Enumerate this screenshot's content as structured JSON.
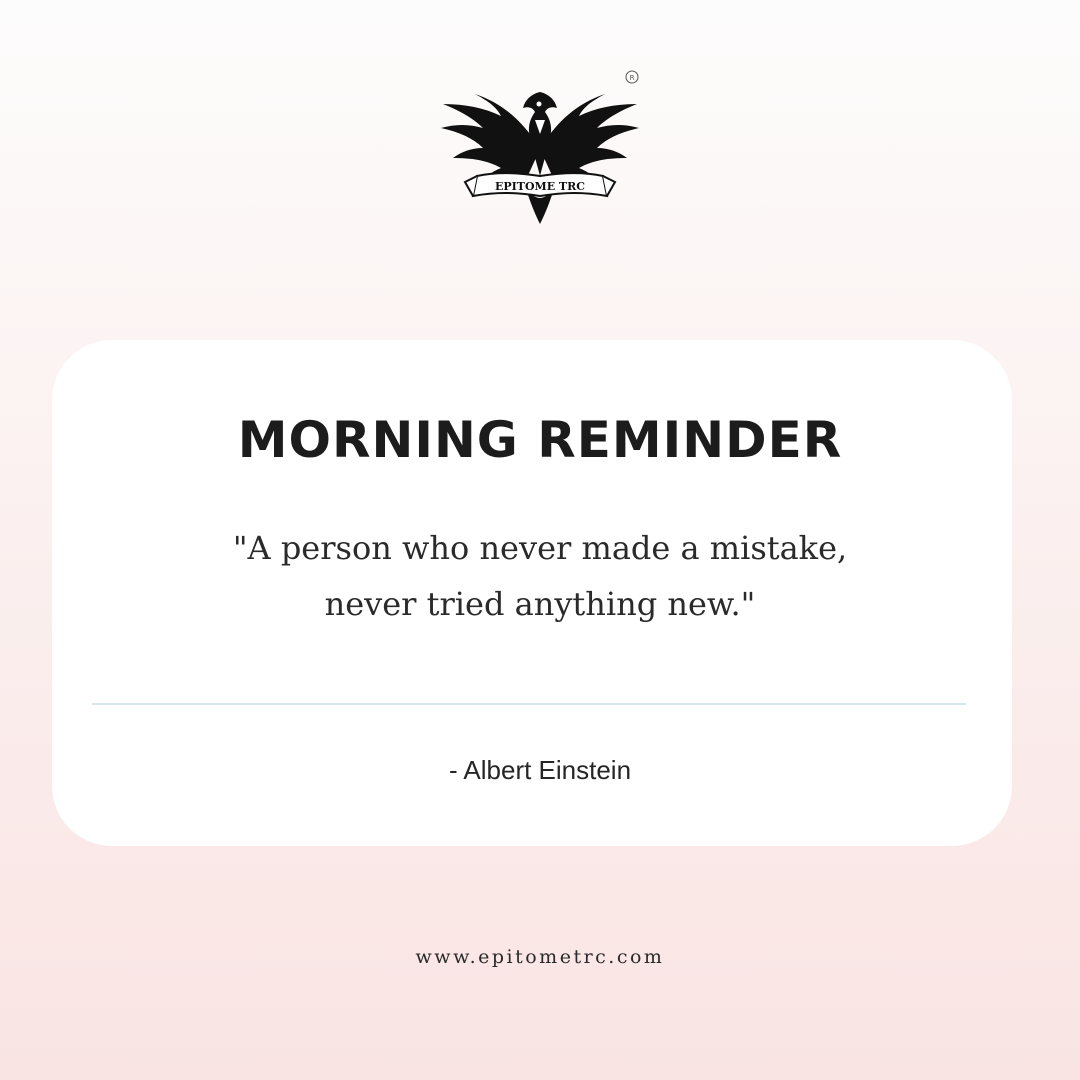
{
  "logo": {
    "icon": "eagle-emblem-icon",
    "banner_text": "EPITOME TRC",
    "registered_mark": "R"
  },
  "card": {
    "title": "MORNING REMINDER",
    "quote_lines": [
      "\"A person who never made a mistake,",
      "never tried anything new.\""
    ],
    "author": "- Albert Einstein"
  },
  "footer": {
    "website": "www.epitometrc.com"
  },
  "colors": {
    "background_top": "#fdfcfc",
    "background_bottom": "#f9e4e3",
    "card": "#ffffff",
    "divider": "#d4e6ec",
    "text": "#1c1c1c"
  }
}
